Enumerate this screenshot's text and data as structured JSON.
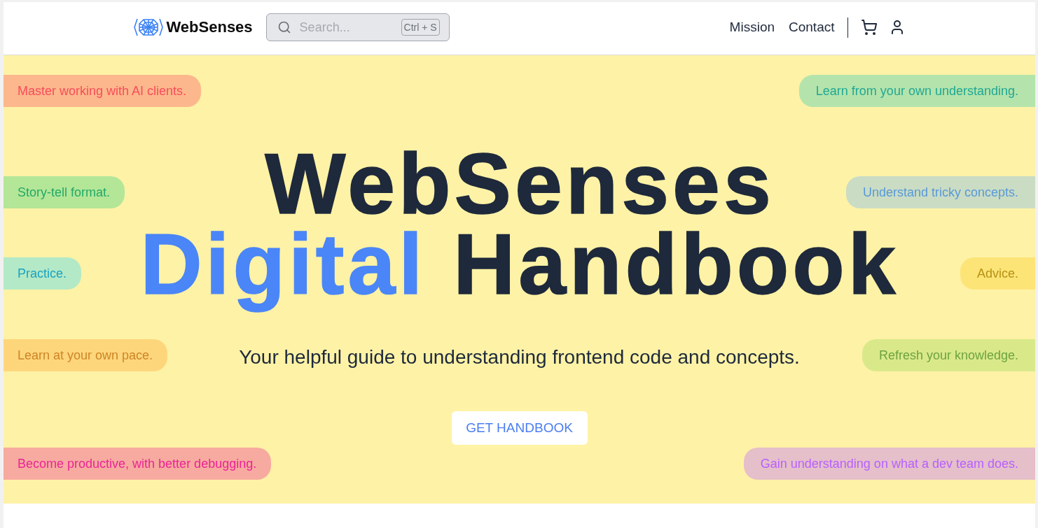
{
  "header": {
    "logo": {
      "text": "WebSenses"
    },
    "search": {
      "placeholder": "Search...",
      "shortcut": "Ctrl + S"
    },
    "nav": [
      {
        "label": "Mission"
      },
      {
        "label": "Contact"
      }
    ]
  },
  "hero": {
    "title": {
      "lines": [
        {
          "words": [
            {
              "text": "WebSenses",
              "highlighted": false
            }
          ]
        },
        {
          "words": [
            {
              "text": "Digital",
              "highlighted": true
            },
            {
              "text": "Handbook",
              "highlighted": false
            }
          ]
        }
      ]
    },
    "subtitle": "Your helpful guide to understanding frontend code and concepts.",
    "cta": "GET HANDBOOK",
    "tag_rows": [
      {
        "tags": [
          {
            "text": "Master working with AI clients.",
            "color": "#fcb88c"
          },
          {
            "text": "Learn from your own understanding.",
            "color": "#b4e4ab"
          }
        ]
      },
      {
        "tags": [
          {
            "text": "Story-tell format.",
            "color": "#b4e698"
          },
          {
            "text": "Understand tricky concepts.",
            "color": "#cadcc4"
          }
        ]
      },
      {
        "tags": [
          {
            "text": "Practice.",
            "color": "#b3e9c6"
          },
          {
            "text": "Advice.",
            "color": "#fde477"
          }
        ]
      },
      {
        "tags": [
          {
            "text": "Learn at your own pace.",
            "color": "#fdd67c"
          },
          {
            "text": "Refresh your knowledge.",
            "color": "#d9e98a"
          }
        ]
      },
      {
        "tags": [
          {
            "text": "Become productive, with better debugging.",
            "color": "#f7aaa0"
          },
          {
            "text": "Gain understanding on what a dev team does.",
            "color": "#e5bfca"
          }
        ]
      }
    ]
  }
}
